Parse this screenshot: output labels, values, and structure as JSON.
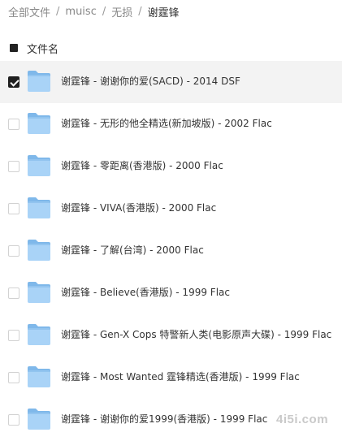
{
  "breadcrumb": {
    "items": [
      "全部文件",
      "muisc",
      "无损"
    ],
    "current": "谢霆锋",
    "separator": "/"
  },
  "header": {
    "column_label": "文件名"
  },
  "files": [
    {
      "name": "谢霆锋 - 谢谢你的爱(SACD) - 2014 DSF",
      "checked": true
    },
    {
      "name": "谢霆锋 - 无形的他全精选(新加坡版) - 2002 Flac",
      "checked": false
    },
    {
      "name": "谢霆锋 - 零距离(香港版) - 2000 Flac",
      "checked": false
    },
    {
      "name": "谢霆锋 - VIVA(香港版) - 2000 Flac",
      "checked": false
    },
    {
      "name": "谢霆锋 - 了解(台湾) - 2000 Flac",
      "checked": false
    },
    {
      "name": "谢霆锋 - Believe(香港版) - 1999 Flac",
      "checked": false
    },
    {
      "name": "谢霆锋 - Gen-X Cops 特警新人类(电影原声大碟) - 1999 Flac",
      "checked": false
    },
    {
      "name": "谢霆锋 - Most Wanted 霆锋精选(香港版) - 1999 Flac",
      "checked": false
    },
    {
      "name": "谢霆锋 - 谢谢你的爱1999(香港版) - 1999 Flac",
      "checked": false
    }
  ],
  "watermark": {
    "text": "4i5i.com"
  },
  "icons": {
    "folder": "folder-icon",
    "checkbox": "checkbox-icon"
  },
  "colors": {
    "folder_back": "#7fb8ea",
    "folder_front": "#a9d3f7",
    "selected_row": "#f3f3f3"
  }
}
